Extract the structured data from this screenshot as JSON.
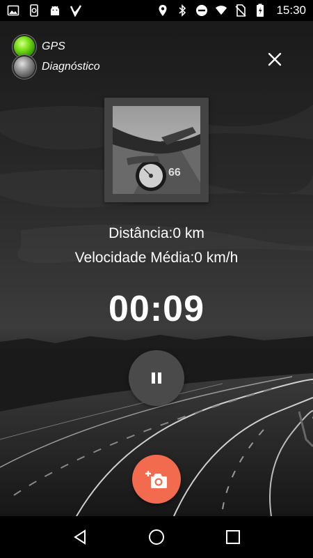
{
  "status_bar": {
    "time": "15:30",
    "left_icons": [
      "image-icon",
      "phone-sync-icon",
      "android-icon",
      "check-icon"
    ],
    "right_icons": [
      "location-icon",
      "bluetooth-icon",
      "do-not-disturb-icon",
      "wifi-icon",
      "no-sim-icon",
      "battery-charging-icon"
    ]
  },
  "indicators": {
    "gps_label": "GPS",
    "gps_state": "active",
    "diagnostico_label": "Diagnóstico",
    "diagnostico_state": "inactive"
  },
  "stats": {
    "distance": "Distância:0 km",
    "avg_speed": "Velocidade Média:0 km/h"
  },
  "timer": "00:09",
  "colors": {
    "camera_button": "#f26b4f",
    "pause_button": "#4a4a4a",
    "gps_led": "#7be11a"
  }
}
